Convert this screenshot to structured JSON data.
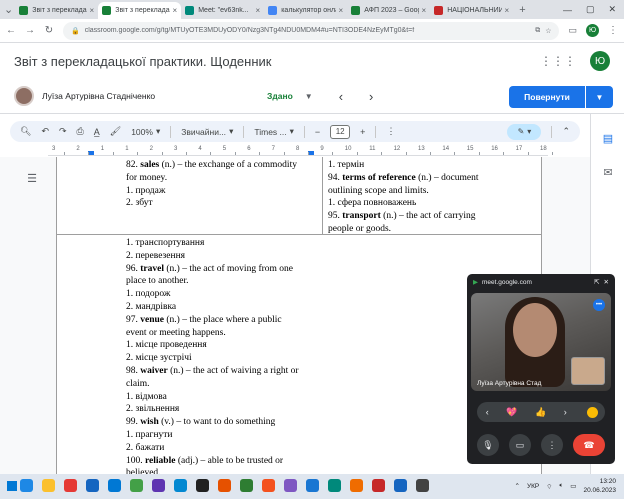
{
  "browser": {
    "tabs": [
      {
        "label": "Звіт з перекладацької",
        "color": "#188038",
        "active": false
      },
      {
        "label": "Звіт з перекладацької",
        "color": "#188038",
        "active": true
      },
      {
        "label": "Meet: \"ev63nk...",
        "color": "#00897b",
        "active": false
      },
      {
        "label": "калькулятор онла...",
        "color": "#4285f4",
        "active": false
      },
      {
        "label": "АФП 2023 – Goog...",
        "color": "#188038",
        "active": false
      },
      {
        "label": "НАЦІОНАЛЬНИЙ",
        "color": "#c62828",
        "active": false
      }
    ],
    "url": "classroom.google.com/g/tg/MTUyOTE3MDUyODY0/Nzg3NTg4NDU0MDM4#u=NTI3ODE4NzEyMTg0&t=f",
    "profile_initial": "Ю"
  },
  "classroom": {
    "title": "Звіт з перекладацької практики. Щоденник",
    "avatar_initial": "Ю",
    "student_name": "Луїза Артурівна Стадніченко",
    "status": "Здано",
    "return_label": "Повернути"
  },
  "toolbar": {
    "zoom": "100%",
    "style": "Звичайни...",
    "font": "Times ...",
    "font_size": "12"
  },
  "ruler": [
    "3",
    "2",
    "1",
    "1",
    "2",
    "3",
    "4",
    "5",
    "6",
    "7",
    "8",
    "9",
    "10",
    "11",
    "12",
    "13",
    "14",
    "15",
    "16",
    "17",
    "18"
  ],
  "doc": {
    "row1_left": [
      {
        "num": "82.",
        "term": "sales",
        "rest": "(n.) – the exchange of a commodity"
      },
      {
        "text": "for money."
      },
      {
        "text": "1. продаж"
      },
      {
        "text": "2. збут"
      }
    ],
    "row1_right": [
      {
        "text": "1. термін"
      },
      {
        "num": "94.",
        "term": "terms of reference",
        "rest": "(n.) – document"
      },
      {
        "text": "outlining scope and limits."
      },
      {
        "text": "1. сфера повноважень"
      },
      {
        "num": "95.",
        "term": "transport",
        "rest": "(n.) – the act of carrying"
      },
      {
        "text": "people or goods."
      }
    ],
    "row2_left": [
      {
        "text": "1. транспортування"
      },
      {
        "text": "2. перевезення"
      },
      {
        "num": "96.",
        "term": "travel",
        "rest": "(n.) – the act of moving from one"
      },
      {
        "text": "place to another."
      },
      {
        "text": "1. подорож"
      },
      {
        "text": "2. мандрівка"
      },
      {
        "num": "97.",
        "term": "venue",
        "rest": "(n.) – the place where a public"
      },
      {
        "text": "event or meeting happens."
      },
      {
        "text": "1. місце проведення"
      },
      {
        "text": "2. місце зустрічі"
      },
      {
        "num": "98.",
        "term": "waiver",
        "rest": "(n.) – the act of waiving a right or"
      },
      {
        "text": "claim."
      },
      {
        "text": "1.  відмова"
      },
      {
        "text": "2. звільнення"
      },
      {
        "num": "99.",
        "term": "wish",
        "rest": "(v.) – to want to do something"
      },
      {
        "text": "1. прагнути"
      },
      {
        "text": "2. бажати"
      },
      {
        "num": "100.",
        "term": "reliable",
        "rest": "(adj.) – able to be trusted or"
      },
      {
        "text": "believed."
      }
    ]
  },
  "meet": {
    "domain": "meet.google.com",
    "participant": "Луїза Артурівна Стад",
    "reactions": [
      "‹",
      "💖",
      "👍",
      "›"
    ]
  },
  "taskbar": {
    "apps_colors": [
      "#1e88e5",
      "#fbc02d",
      "#e53935",
      "#1565c0",
      "#0078d4",
      "#43a047",
      "#5e35b1",
      "#0288d1",
      "#212121",
      "#e65100",
      "#2e7d32",
      "#f4511e",
      "#7e57c2",
      "#1976d2",
      "#00897b",
      "#ef6c00",
      "#c62828",
      "#1565c0",
      "#424242"
    ],
    "lang": "УКР",
    "time": "13:20",
    "date": "20.06.2023"
  }
}
